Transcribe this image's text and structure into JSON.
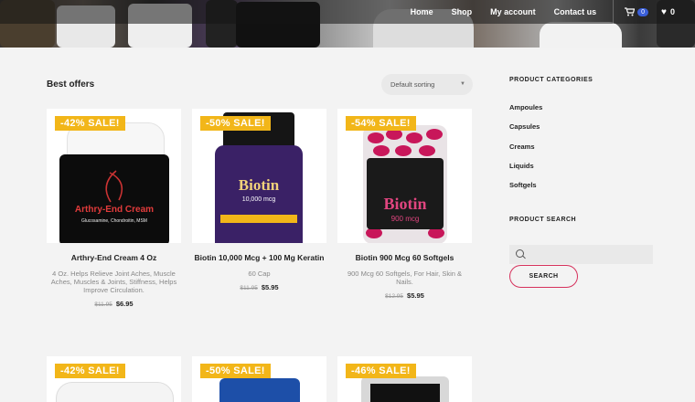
{
  "nav": {
    "items": [
      "Home",
      "Shop",
      "My account",
      "Contact us"
    ],
    "cart_count": "0",
    "wishlist_count": "0"
  },
  "main": {
    "title": "Best offers",
    "sort_label": "Default sorting"
  },
  "products": [
    {
      "sale": "-42% SALE!",
      "name": "Arthry-End Cream 4 Oz",
      "desc": "4 Oz. Helps Relieve Joint Aches, Muscle Aches, Muscles & Joints, Stiffness, Helps Improve Circulation.",
      "old_price": "$11.95",
      "price": "$6.95",
      "label_title": "Arthry-End Cream",
      "label_sub": "Glucosamine, Chondroitin, MSM"
    },
    {
      "sale": "-50% SALE!",
      "name": "Biotin 10,000 Mcg + 100 Mg Keratin",
      "desc": "60 Cap",
      "old_price": "$11.95",
      "price": "$5.95",
      "label_title": "Biotin",
      "label_sub": "10,000 mcg"
    },
    {
      "sale": "-54% SALE!",
      "name": "Biotin 900 Mcg 60 Softgels",
      "desc": "900 Mcg 60 Softgels, For Hair, Skin & Nails.",
      "old_price": "$12.95",
      "price": "$5.95",
      "label_title": "Biotin",
      "label_sub": "900 mcg"
    },
    {
      "sale": "-42% SALE!"
    },
    {
      "sale": "-50% SALE!"
    },
    {
      "sale": "-46% SALE!"
    }
  ],
  "sidebar": {
    "categories_heading": "PRODUCT CATEGORIES",
    "categories": [
      "Ampoules",
      "Capsules",
      "Creams",
      "Liquids",
      "Softgels"
    ],
    "search_heading": "PRODUCT SEARCH",
    "search_button": "SEARCH"
  },
  "colors": {
    "sale_badge": "#f2b619",
    "search_button_border": "#d6315c",
    "cart_badge": "#3a5fd9"
  }
}
